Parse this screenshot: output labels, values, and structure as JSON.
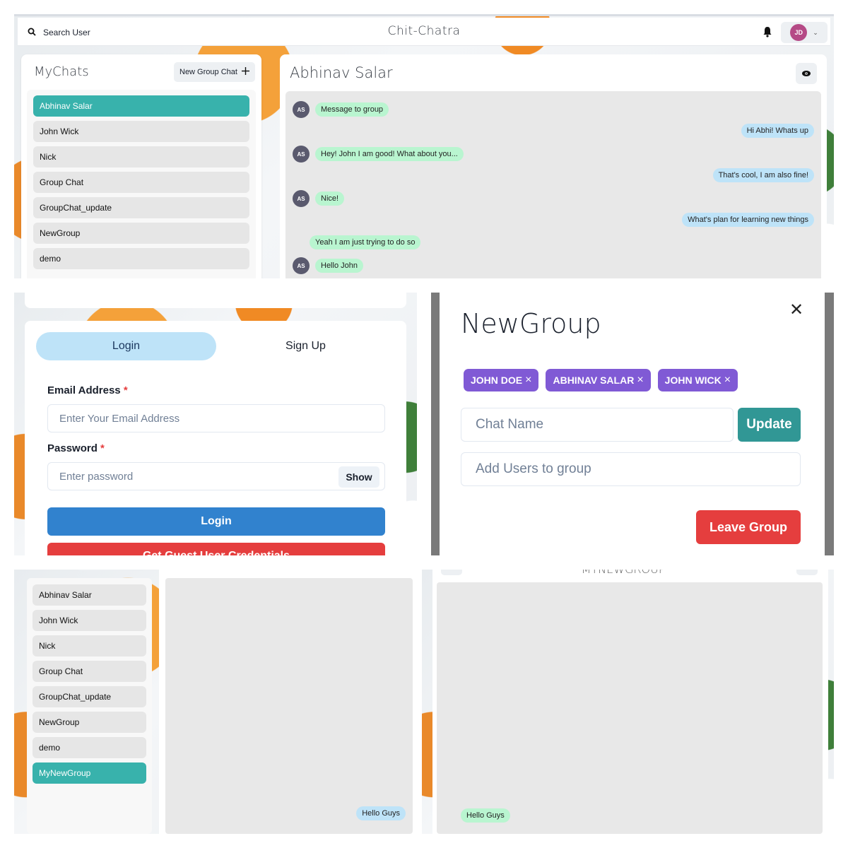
{
  "chat_app": {
    "search_label": "Search User",
    "app_title": "Chit-Chatra",
    "user_initials": "JD",
    "mychats_title": "MyChats",
    "new_group_label": "New Group Chat",
    "chats": [
      "Abhinav Salar",
      "John Wick",
      "Nick",
      "Group Chat",
      "GroupChat_update",
      "NewGroup",
      "demo"
    ],
    "active_chat": "Abhinav Salar",
    "chat_header": "Abhinav Salar",
    "avatar_initials": "AS",
    "messages": [
      {
        "side": "left",
        "text": "Message to group",
        "avatar": true
      },
      {
        "side": "right",
        "text": "Hi Abhi! Whats up"
      },
      {
        "side": "left",
        "text": "Hey! John I am good! What about you...",
        "avatar": true
      },
      {
        "side": "right",
        "text": "That's cool, I am also fine!"
      },
      {
        "side": "left",
        "text": "Nice!",
        "avatar": true
      },
      {
        "side": "right",
        "text": "What's plan for learning new things"
      },
      {
        "side": "left",
        "text": "Yeah I am just trying to do so",
        "avatar": false
      },
      {
        "side": "left",
        "text": "Hello John",
        "avatar": true
      }
    ]
  },
  "login": {
    "tab_login": "Login",
    "tab_signup": "Sign Up",
    "email_label": "Email Address",
    "required_mark": "*",
    "email_placeholder": "Enter Your Email Address",
    "password_label": "Password",
    "password_placeholder": "Enter password",
    "show_label": "Show",
    "login_button": "Login",
    "guest_button": "Get Guest User Credentials"
  },
  "group_modal": {
    "title": "NewGroup",
    "members": [
      "JOHN DOE",
      "ABHINAV SALAR",
      "JOHN WICK"
    ],
    "remove_mark": "×",
    "chat_name_placeholder": "Chat Name",
    "update_label": "Update",
    "add_users_placeholder": "Add Users to group",
    "leave_label": "Leave Group"
  },
  "sidebar_view": {
    "chats": [
      "Abhinav Salar",
      "John Wick",
      "Nick",
      "Group Chat",
      "GroupChat_update",
      "NewGroup",
      "demo",
      "MyNewGroup"
    ],
    "active_chat": "MyNewGroup",
    "right_message": "Hello Guys"
  },
  "group_view": {
    "title": "MYNEWGROUP",
    "left_message": "Hello Guys"
  },
  "colors": {
    "teal_active": "#38b2ac",
    "sent_bubble": "#bee3f8",
    "received_bubble": "#b9f5d0",
    "badge_purple": "#805ad5",
    "login_blue": "#3182ce",
    "danger_red": "#e53e3e",
    "update_teal": "#319795"
  }
}
